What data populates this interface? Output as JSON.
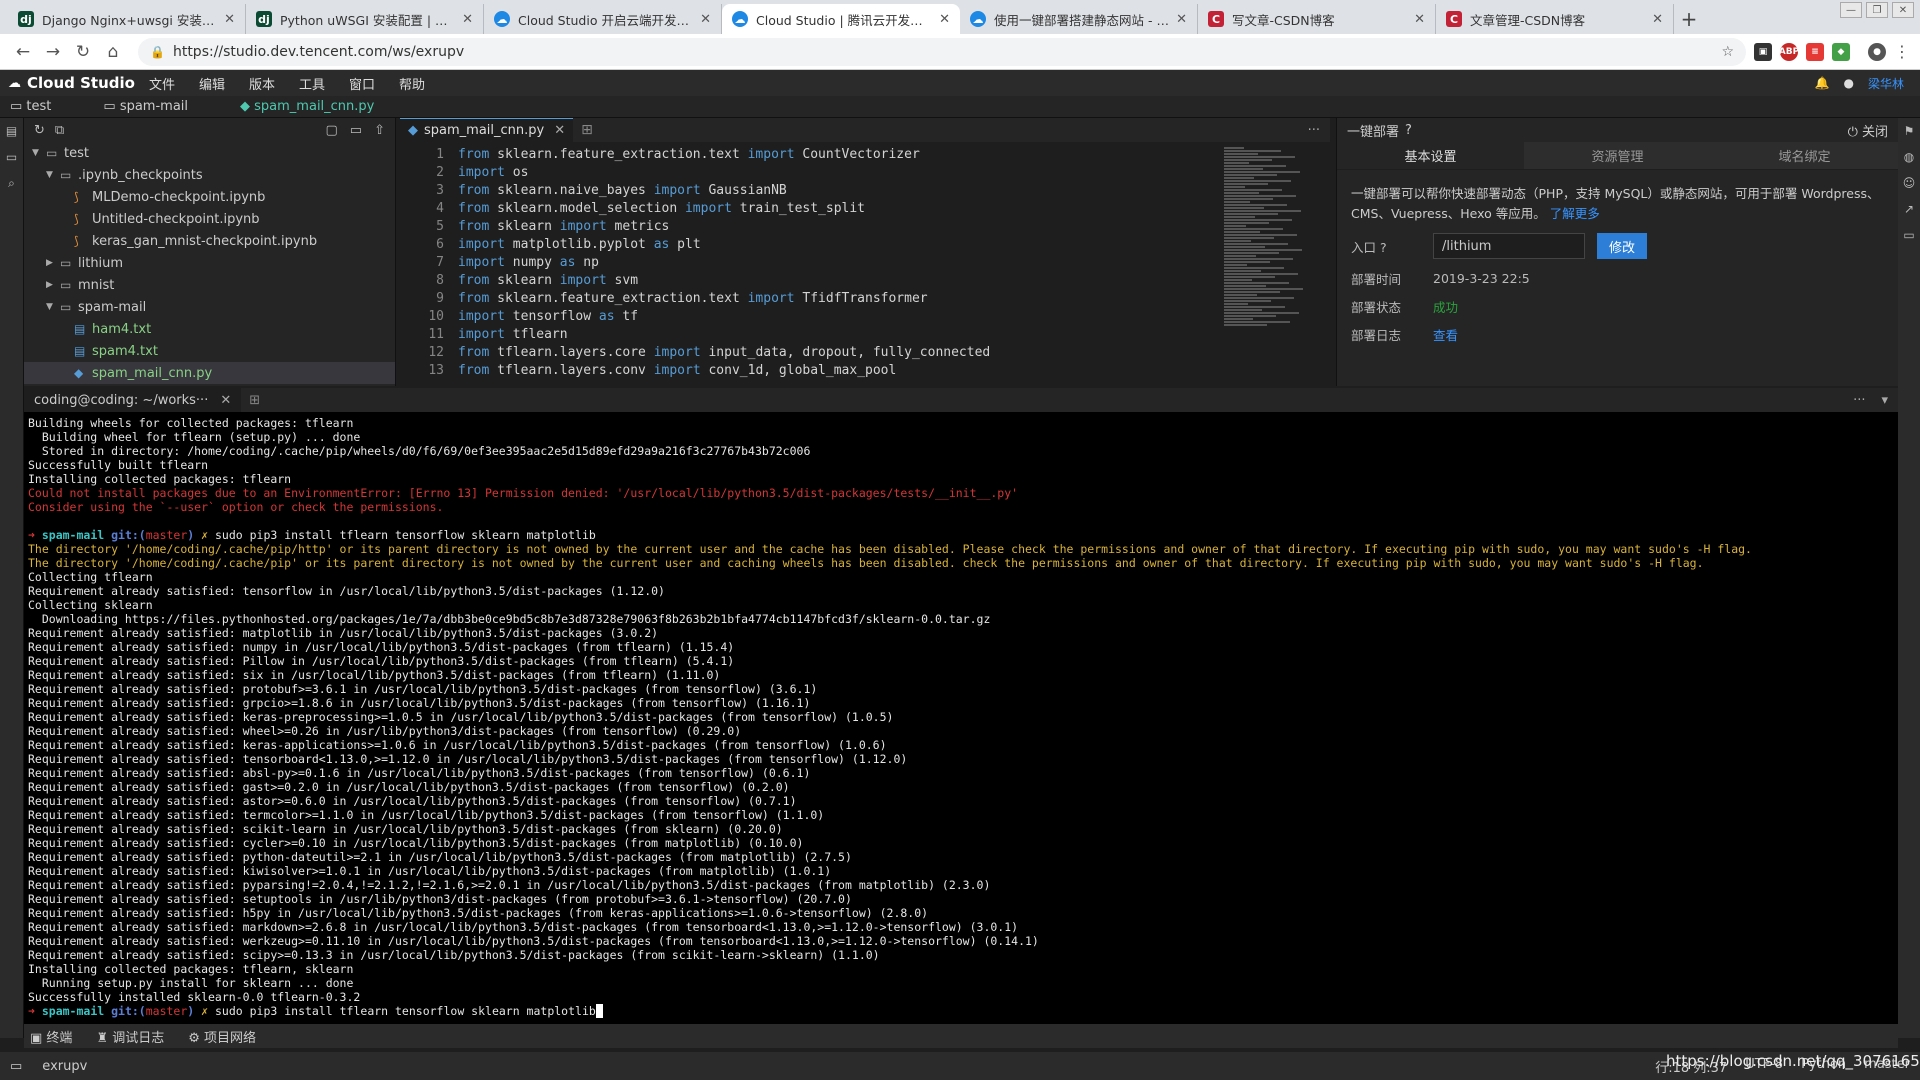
{
  "browser": {
    "tabs": [
      {
        "title": "Django Nginx+uwsgi 安装配置 |",
        "favicon": "django"
      },
      {
        "title": "Python uWSGI 安装配置 | 菜鸟教",
        "favicon": "django"
      },
      {
        "title": "Cloud Studio 开启云端开发模式",
        "favicon": "cloud-studio"
      },
      {
        "title": "Cloud Studio | 腾讯云开发者平台",
        "favicon": "cloud-studio"
      },
      {
        "title": "使用一键部署搭建静态网站 - 腾讯",
        "favicon": "cloud-studio"
      },
      {
        "title": "写文章-CSDN博客",
        "favicon": "csdn"
      },
      {
        "title": "文章管理-CSDN博客",
        "favicon": "csdn"
      }
    ],
    "url": "https://studio.dev.tencent.com/ws/exrupv"
  },
  "app": {
    "name": "Cloud Studio",
    "menu": [
      "文件",
      "编辑",
      "版本",
      "工具",
      "窗口",
      "帮助"
    ],
    "user": "梁华林"
  },
  "breadcrumb": [
    "test",
    "spam-mail",
    "spam_mail_cnn.py"
  ],
  "explorer": {
    "items": [
      {
        "label": "test",
        "type": "folder",
        "depth": 0,
        "open": true
      },
      {
        "label": ".ipynb_checkpoints",
        "type": "folder",
        "depth": 1,
        "open": true
      },
      {
        "label": "MLDemo-checkpoint.ipynb",
        "type": "notebook",
        "depth": 2
      },
      {
        "label": "Untitled-checkpoint.ipynb",
        "type": "notebook",
        "depth": 2
      },
      {
        "label": "keras_gan_mnist-checkpoint.ipynb",
        "type": "notebook",
        "depth": 2
      },
      {
        "label": "lithium",
        "type": "folder",
        "depth": 1,
        "open": false
      },
      {
        "label": "mnist",
        "type": "folder",
        "depth": 1,
        "open": false
      },
      {
        "label": "spam-mail",
        "type": "folder",
        "depth": 1,
        "open": true
      },
      {
        "label": "ham4.txt",
        "type": "text",
        "depth": 2
      },
      {
        "label": "spam4.txt",
        "type": "text",
        "depth": 2
      },
      {
        "label": "spam_mail_cnn.py",
        "type": "python",
        "depth": 2,
        "selected": true
      }
    ]
  },
  "editor": {
    "tab": "spam_mail_cnn.py",
    "lines": [
      [
        [
          "from",
          "kw"
        ],
        [
          " sklearn.feature_extraction.text ",
          "id"
        ],
        [
          "import",
          "kw"
        ],
        [
          " CountVectorizer",
          "id"
        ]
      ],
      [
        [
          "import",
          "kw"
        ],
        [
          " os",
          "id"
        ]
      ],
      [
        [
          "from",
          "kw"
        ],
        [
          " sklearn.naive_bayes ",
          "id"
        ],
        [
          "import",
          "kw"
        ],
        [
          " GaussianNB",
          "id"
        ]
      ],
      [
        [
          "from",
          "kw"
        ],
        [
          " sklearn.model_selection ",
          "id"
        ],
        [
          "import",
          "kw"
        ],
        [
          " train_test_split",
          "id"
        ]
      ],
      [
        [
          "from",
          "kw"
        ],
        [
          " sklearn ",
          "id"
        ],
        [
          "import",
          "kw"
        ],
        [
          " metrics",
          "id"
        ]
      ],
      [
        [
          "import",
          "kw"
        ],
        [
          " matplotlib.pyplot ",
          "id"
        ],
        [
          "as",
          "kw"
        ],
        [
          " plt",
          "id"
        ]
      ],
      [
        [
          "import",
          "kw"
        ],
        [
          " numpy ",
          "id"
        ],
        [
          "as",
          "kw"
        ],
        [
          " np",
          "id"
        ]
      ],
      [
        [
          "from",
          "kw"
        ],
        [
          " sklearn ",
          "id"
        ],
        [
          "import",
          "kw"
        ],
        [
          " svm",
          "id"
        ]
      ],
      [
        [
          "from",
          "kw"
        ],
        [
          " sklearn.feature_extraction.text ",
          "id"
        ],
        [
          "import",
          "kw"
        ],
        [
          " TfidfTransformer",
          "id"
        ]
      ],
      [
        [
          "import",
          "kw"
        ],
        [
          " tensorflow ",
          "id"
        ],
        [
          "as",
          "kw"
        ],
        [
          " tf",
          "id"
        ]
      ],
      [
        [
          "import",
          "kw"
        ],
        [
          " tflearn",
          "id"
        ]
      ],
      [
        [
          "from",
          "kw"
        ],
        [
          " tflearn.layers.core ",
          "id"
        ],
        [
          "import",
          "kw"
        ],
        [
          " input_data, dropout, fully_connected",
          "id"
        ]
      ],
      [
        [
          "from",
          "kw"
        ],
        [
          " tflearn.layers.conv ",
          "id"
        ],
        [
          "import",
          "kw"
        ],
        [
          " conv_1d, global_max_pool",
          "id"
        ]
      ]
    ]
  },
  "deploy": {
    "title": "一键部署",
    "close": "关闭",
    "tabs": [
      "基本设置",
      "资源管理",
      "域名绑定"
    ],
    "desc": "一键部署可以帮你快速部署动态（PHP，支持 MySQL）或静态网站，可用于部署 Wordpress、CMS、Vuepress、Hexo 等应用。",
    "learn_more": "了解更多",
    "entry_label": "入口",
    "entry_value": "/lithium",
    "edit_button": "修改",
    "time_label": "部署时间",
    "time_value": "2019-3-23 22:5",
    "status_label": "部署状态",
    "status_value": "成功",
    "log_label": "部署日志",
    "log_value": "查看"
  },
  "terminal": {
    "tab": "coding@coding: ~/works···",
    "lines": [
      [
        [
          "Building wheels for collected packages: tflearn",
          ""
        ]
      ],
      [
        [
          "  Building wheel for tflearn (setup.py) ... done",
          ""
        ]
      ],
      [
        [
          "  Stored in directory: /home/coding/.cache/pip/wheels/d0/f6/69/0ef3ee395aac2e5d15d89efd29a9a216f3c27767b43b72c006",
          ""
        ]
      ],
      [
        [
          "Successfully built tflearn",
          ""
        ]
      ],
      [
        [
          "Installing collected packages: tflearn",
          ""
        ]
      ],
      [
        [
          "Could not install packages due to an EnvironmentError: [Errno 13] Permission denied: '/usr/local/lib/python3.5/dist-packages/tests/__init__.py'",
          "red"
        ]
      ],
      [
        [
          "Consider using the `--user` option or check the permissions.",
          "red"
        ]
      ],
      [
        [
          "",
          ""
        ]
      ],
      [
        [
          "➜ ",
          "prompt"
        ],
        [
          "spam-mail ",
          "dir"
        ],
        [
          "git:(",
          "git"
        ],
        [
          "master",
          "br"
        ],
        [
          ") ",
          "git"
        ],
        [
          "✗ ",
          "yel"
        ],
        [
          "sudo pip3 install tflearn tensorflow sklearn matplotlib",
          ""
        ]
      ],
      [
        [
          "The directory '/home/coding/.cache/pip/http' or its parent directory is not owned by the current user and the cache has been disabled. Please check the permissions and owner of that directory. If executing pip with sudo, you may want sudo's -H flag.",
          "yel"
        ]
      ],
      [
        [
          "The directory '/home/coding/.cache/pip' or its parent directory is not owned by the current user and caching wheels has been disabled. check the permissions and owner of that directory. If executing pip with sudo, you may want sudo's -H flag.",
          "yel"
        ]
      ],
      [
        [
          "Collecting tflearn",
          ""
        ]
      ],
      [
        [
          "Requirement already satisfied: tensorflow in /usr/local/lib/python3.5/dist-packages (1.12.0)",
          ""
        ]
      ],
      [
        [
          "Collecting sklearn",
          ""
        ]
      ],
      [
        [
          "  Downloading https://files.pythonhosted.org/packages/1e/7a/dbb3be0ce9bd5c8b7e3d87328e79063f8b263b2b1bfa4774cb1147bfcd3f/sklearn-0.0.tar.gz",
          ""
        ]
      ],
      [
        [
          "Requirement already satisfied: matplotlib in /usr/local/lib/python3.5/dist-packages (3.0.2)",
          ""
        ]
      ],
      [
        [
          "Requirement already satisfied: numpy in /usr/local/lib/python3.5/dist-packages (from tflearn) (1.15.4)",
          ""
        ]
      ],
      [
        [
          "Requirement already satisfied: Pillow in /usr/local/lib/python3.5/dist-packages (from tflearn) (5.4.1)",
          ""
        ]
      ],
      [
        [
          "Requirement already satisfied: six in /usr/local/lib/python3.5/dist-packages (from tflearn) (1.11.0)",
          ""
        ]
      ],
      [
        [
          "Requirement already satisfied: protobuf>=3.6.1 in /usr/local/lib/python3.5/dist-packages (from tensorflow) (3.6.1)",
          ""
        ]
      ],
      [
        [
          "Requirement already satisfied: grpcio>=1.8.6 in /usr/local/lib/python3.5/dist-packages (from tensorflow) (1.16.1)",
          ""
        ]
      ],
      [
        [
          "Requirement already satisfied: keras-preprocessing>=1.0.5 in /usr/local/lib/python3.5/dist-packages (from tensorflow) (1.0.5)",
          ""
        ]
      ],
      [
        [
          "Requirement already satisfied: wheel>=0.26 in /usr/lib/python3/dist-packages (from tensorflow) (0.29.0)",
          ""
        ]
      ],
      [
        [
          "Requirement already satisfied: keras-applications>=1.0.6 in /usr/local/lib/python3.5/dist-packages (from tensorflow) (1.0.6)",
          ""
        ]
      ],
      [
        [
          "Requirement already satisfied: tensorboard<1.13.0,>=1.12.0 in /usr/local/lib/python3.5/dist-packages (from tensorflow) (1.12.0)",
          ""
        ]
      ],
      [
        [
          "Requirement already satisfied: absl-py>=0.1.6 in /usr/local/lib/python3.5/dist-packages (from tensorflow) (0.6.1)",
          ""
        ]
      ],
      [
        [
          "Requirement already satisfied: gast>=0.2.0 in /usr/local/lib/python3.5/dist-packages (from tensorflow) (0.2.0)",
          ""
        ]
      ],
      [
        [
          "Requirement already satisfied: astor>=0.6.0 in /usr/local/lib/python3.5/dist-packages (from tensorflow) (0.7.1)",
          ""
        ]
      ],
      [
        [
          "Requirement already satisfied: termcolor>=1.1.0 in /usr/local/lib/python3.5/dist-packages (from tensorflow) (1.1.0)",
          ""
        ]
      ],
      [
        [
          "Requirement already satisfied: scikit-learn in /usr/local/lib/python3.5/dist-packages (from sklearn) (0.20.0)",
          ""
        ]
      ],
      [
        [
          "Requirement already satisfied: cycler>=0.10 in /usr/local/lib/python3.5/dist-packages (from matplotlib) (0.10.0)",
          ""
        ]
      ],
      [
        [
          "Requirement already satisfied: python-dateutil>=2.1 in /usr/local/lib/python3.5/dist-packages (from matplotlib) (2.7.5)",
          ""
        ]
      ],
      [
        [
          "Requirement already satisfied: kiwisolver>=1.0.1 in /usr/local/lib/python3.5/dist-packages (from matplotlib) (1.0.1)",
          ""
        ]
      ],
      [
        [
          "Requirement already satisfied: pyparsing!=2.0.4,!=2.1.2,!=2.1.6,>=2.0.1 in /usr/local/lib/python3.5/dist-packages (from matplotlib) (2.3.0)",
          ""
        ]
      ],
      [
        [
          "Requirement already satisfied: setuptools in /usr/lib/python3/dist-packages (from protobuf>=3.6.1->tensorflow) (20.7.0)",
          ""
        ]
      ],
      [
        [
          "Requirement already satisfied: h5py in /usr/local/lib/python3.5/dist-packages (from keras-applications>=1.0.6->tensorflow) (2.8.0)",
          ""
        ]
      ],
      [
        [
          "Requirement already satisfied: markdown>=2.6.8 in /usr/local/lib/python3.5/dist-packages (from tensorboard<1.13.0,>=1.12.0->tensorflow) (3.0.1)",
          ""
        ]
      ],
      [
        [
          "Requirement already satisfied: werkzeug>=0.11.10 in /usr/local/lib/python3.5/dist-packages (from tensorboard<1.13.0,>=1.12.0->tensorflow) (0.14.1)",
          ""
        ]
      ],
      [
        [
          "Requirement already satisfied: scipy>=0.13.3 in /usr/local/lib/python3.5/dist-packages (from scikit-learn->sklearn) (1.1.0)",
          ""
        ]
      ],
      [
        [
          "Installing collected packages: tflearn, sklearn",
          ""
        ]
      ],
      [
        [
          "  Running setup.py install for sklearn ... done",
          ""
        ]
      ],
      [
        [
          "Successfully installed sklearn-0.0 tflearn-0.3.2",
          ""
        ]
      ],
      [
        [
          "➜ ",
          "prompt"
        ],
        [
          "spam-mail ",
          "dir"
        ],
        [
          "git:(",
          "git"
        ],
        [
          "master",
          "br"
        ],
        [
          ") ",
          "git"
        ],
        [
          "✗ ",
          "yel"
        ],
        [
          "sudo pip3 install tflearn tensorflow sklearn matplotlib",
          ""
        ],
        [
          " ",
          "cursor"
        ]
      ]
    ]
  },
  "bottom_tabs": [
    "终端",
    "调试日志",
    "项目网络"
  ],
  "status": {
    "workspace": "exrupv",
    "items": [
      "行:18 列:37",
      "UTF-8",
      "Python",
      "master"
    ],
    "watermark": "https://blog.csdn.net/qq_30761653"
  }
}
